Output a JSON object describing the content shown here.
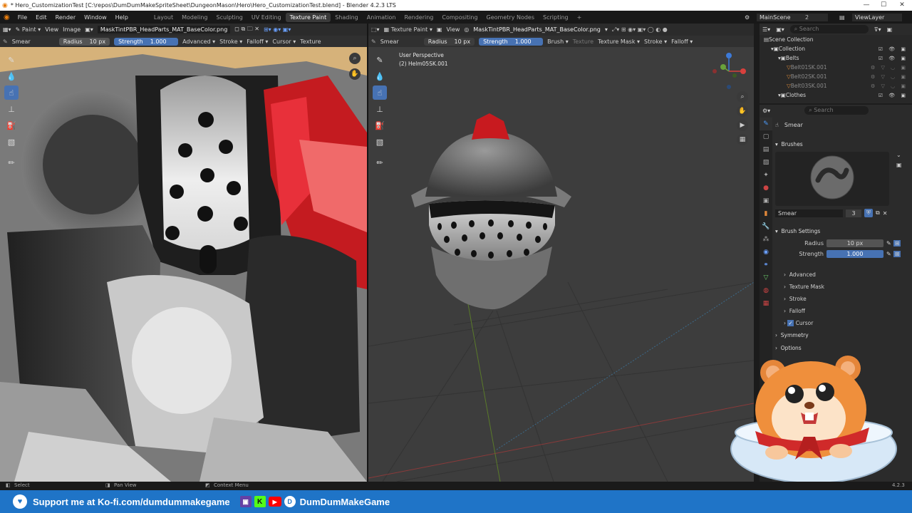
{
  "window": {
    "title": "* Hero_CustomizationTest [C:\\repos\\DumDumMakeSpriteSheet\\DungeonMason\\Hero\\Hero_CustomizationTest.blend] - Blender 4.2.3 LTS"
  },
  "menu": [
    "File",
    "Edit",
    "Render",
    "Window",
    "Help"
  ],
  "workspaces": [
    "Layout",
    "Modeling",
    "Sculpting",
    "UV Editing",
    "Texture Paint",
    "Shading",
    "Animation",
    "Rendering",
    "Compositing",
    "Geometry Nodes",
    "Scripting"
  ],
  "active_workspace": "Texture Paint",
  "scene": {
    "name": "MainScene",
    "viewlayer": "ViewLayer",
    "num": "2"
  },
  "image_editor": {
    "header": {
      "mode": "Paint",
      "view": "View",
      "image_menu": "Image",
      "image_name": "MaskTintPBR_HeadParts_MAT_BaseColor.png"
    },
    "toolsettings": {
      "brush": "Smear",
      "radius_label": "Radius",
      "radius_value": "10 px",
      "strength_label": "Strength",
      "strength_value": "1.000",
      "advanced": "Advanced",
      "stroke": "Stroke",
      "falloff": "Falloff",
      "cursor": "Cursor",
      "texture": "Texture"
    }
  },
  "viewport": {
    "header": {
      "mode": "Texture Paint",
      "view": "View",
      "image_name": "MaskTintPBR_HeadParts_MAT_BaseColor.png"
    },
    "toolsettings": {
      "brush": "Smear",
      "radius_label": "Radius",
      "radius_value": "10 px",
      "strength_label": "Strength",
      "strength_value": "1.000",
      "brush_menu": "Brush",
      "texture": "Texture",
      "texture_mask": "Texture Mask",
      "stroke": "Stroke",
      "falloff": "Falloff"
    },
    "overlay": {
      "perspective": "User Perspective",
      "object": "(2) Helm05SK.001"
    }
  },
  "outliner": {
    "search_placeholder": "Search",
    "scene_collection": "Scene Collection",
    "collection": "Collection",
    "belts": "Belts",
    "items": [
      "Belt01SK.001",
      "Belt02SK.001",
      "Belt03SK.001"
    ],
    "clothes": "Clothes"
  },
  "properties": {
    "search_placeholder": "Search",
    "brush_name": "Smear",
    "brushes_label": "Brushes",
    "brush_field": "Smear",
    "brush_users": "3",
    "brush_settings": "Brush Settings",
    "radius_label": "Radius",
    "radius_value": "10 px",
    "strength_label": "Strength",
    "strength_value": "1.000",
    "sub_panels": [
      "Advanced",
      "Texture Mask",
      "Stroke",
      "Falloff"
    ],
    "cursor_label": "Cursor",
    "symmetry": "Symmetry",
    "options": "Options"
  },
  "status": {
    "select": "Select",
    "pan": "Pan View",
    "context": "Context Menu",
    "version": "4.2.3"
  },
  "banner": {
    "text1": "Support me at Ko-fi.com/dumdummakegame",
    "text2": "DumDumMakeGame"
  },
  "colors": {
    "accent": "#4772b3",
    "banner": "#1f74c7",
    "helmet_plume": "#c81a1f"
  }
}
